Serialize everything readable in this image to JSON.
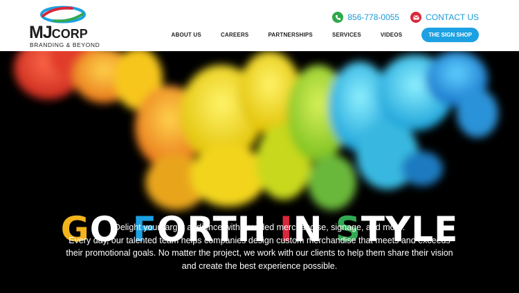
{
  "logo": {
    "main_a": "MJ",
    "main_b": "CORP",
    "tagline": "BRANDING & BEYOND"
  },
  "contact": {
    "phone": "856-778-0055",
    "email_label": "CONTACT US"
  },
  "nav": {
    "items": [
      {
        "label": "ABOUT US"
      },
      {
        "label": "CAREERS"
      },
      {
        "label": "PARTNERSHIPS"
      },
      {
        "label": "SERVICES"
      },
      {
        "label": "VIDEOS"
      }
    ],
    "cta": "THE SIGN SHOP"
  },
  "hero": {
    "title_letters": {
      "g": "G",
      "o1": "O",
      "space1": " ",
      "f": "F",
      "orth": "ORTH",
      "space2": " ",
      "i": "I",
      "n": "N",
      "space3": " ",
      "s": "S",
      "tyle": "TYLE"
    },
    "lines": [
      "Delight your target audience with branded merchandise, signage, and more.",
      "Every day, our talented team helps companies design custom merchandise that meets and exceeds their promotional goals. No matter the project, we work with our clients to help them share their vision and create the best experience possible."
    ]
  },
  "colors": {
    "accent_blue": "#1da1e2",
    "phone_green": "#2ea84a",
    "mail_red": "#d8283a",
    "title_yellow": "#f2b41c",
    "title_green": "#33a853"
  },
  "icons": {
    "phone": "phone-icon",
    "mail": "mail-icon",
    "logo": "logo-swoosh-icon"
  }
}
